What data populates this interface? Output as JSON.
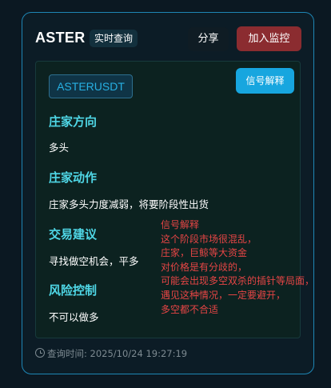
{
  "header": {
    "title": "ASTER",
    "realtime_tag": "实时查询",
    "share_label": "分享",
    "monitor_label": "加入监控"
  },
  "panel": {
    "symbol": "ASTERUSDT",
    "signal_button_label": "信号解释",
    "sections": [
      {
        "title": "庄家方向",
        "content": "多头"
      },
      {
        "title": "庄家动作",
        "content": "庄家多头力度减弱，将要阶段性出货"
      },
      {
        "title": "交易建议",
        "content": "寻找做空机会，平多"
      },
      {
        "title": "风险控制",
        "content": "不可以做多"
      }
    ]
  },
  "footer": {
    "query_time": "查询时间: 2025/10/24 19:27:19"
  },
  "annotation": {
    "lines": [
      "信号解释",
      "这个阶段市场很混乱，",
      "庄家，巨鲸等大资金",
      "对价格是有分歧的，",
      "可能会出现多空双杀的插针等局面，",
      "遇见这种情况，一定要避开，",
      "多空都不合适"
    ]
  },
  "colors": {
    "accent": "#17a6df",
    "danger": "#8b2c30",
    "section_title": "#4fd7e6",
    "annotation": "#e64545"
  }
}
